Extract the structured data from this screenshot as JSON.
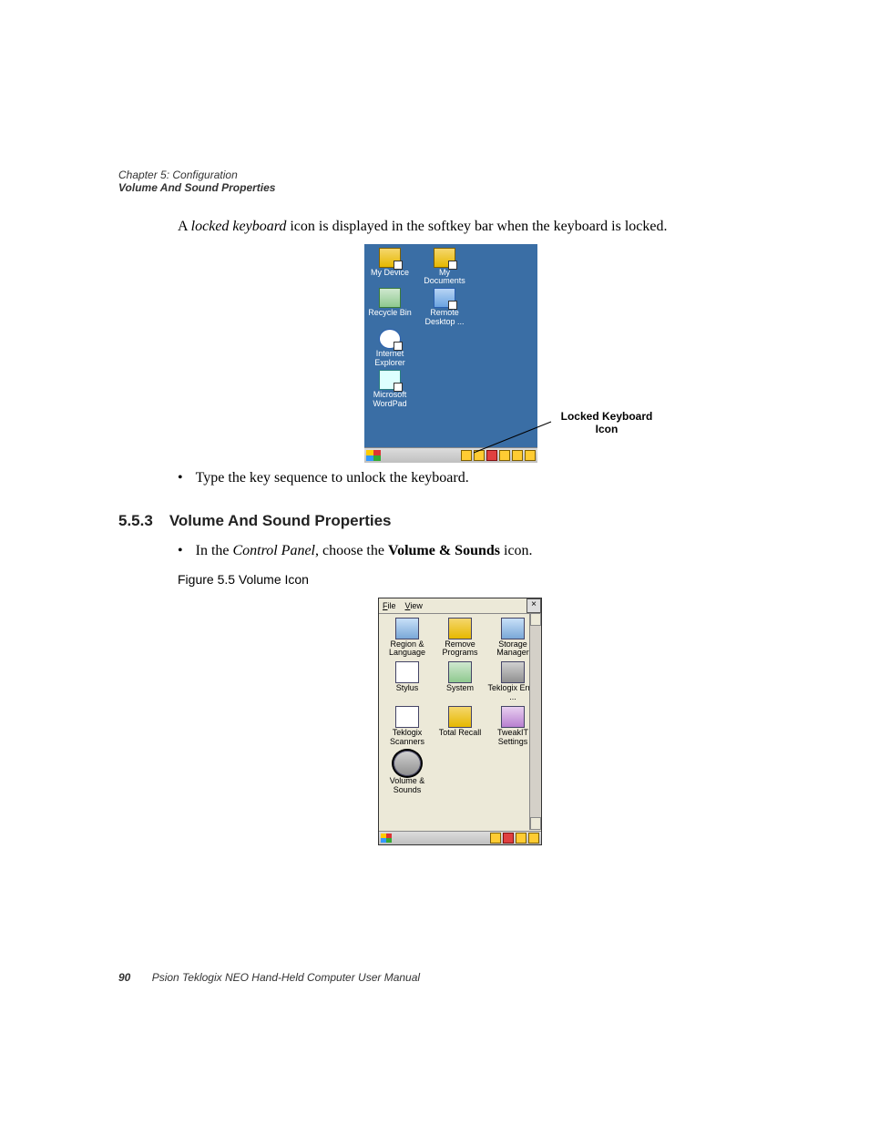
{
  "header": {
    "chapter": "Chapter 5: Configuration",
    "section": "Volume And Sound Properties"
  },
  "intro": {
    "prefix": "A ",
    "italic": "locked keyboard",
    "suffix": " icon is displayed in the softkey bar when the keyboard is locked."
  },
  "desktop": {
    "icons": [
      {
        "label": "My Device"
      },
      {
        "label": "My Documents"
      },
      {
        "label": "Recycle Bin"
      },
      {
        "label": "Remote Desktop ..."
      },
      {
        "label": "Internet Explorer"
      },
      {
        "label": ""
      },
      {
        "label": "Microsoft WordPad"
      }
    ],
    "callout": "Locked Keyboard Icon"
  },
  "bullet1": "Type the key sequence to unlock the keyboard.",
  "section": {
    "number": "5.5.3",
    "title": "Volume And Sound Properties"
  },
  "bullet2": {
    "prefix": "In the ",
    "italic": "Control Panel",
    "mid": ", choose the ",
    "bold": "Volume & Sounds",
    "suffix": " icon."
  },
  "figure_caption": "Figure 5.5  Volume Icon",
  "control_panel": {
    "menus": [
      "File",
      "View"
    ],
    "close": "×",
    "icons": [
      "Region & Language",
      "Remove Programs",
      "Storage Manager",
      "Stylus",
      "System",
      "Teklogix Error ...",
      "Teklogix Scanners",
      "Total Recall",
      "TweakIT Settings",
      "Volume & Sounds"
    ]
  },
  "footer": {
    "page": "90",
    "text": "Psion Teklogix NEO Hand-Held Computer User Manual"
  }
}
